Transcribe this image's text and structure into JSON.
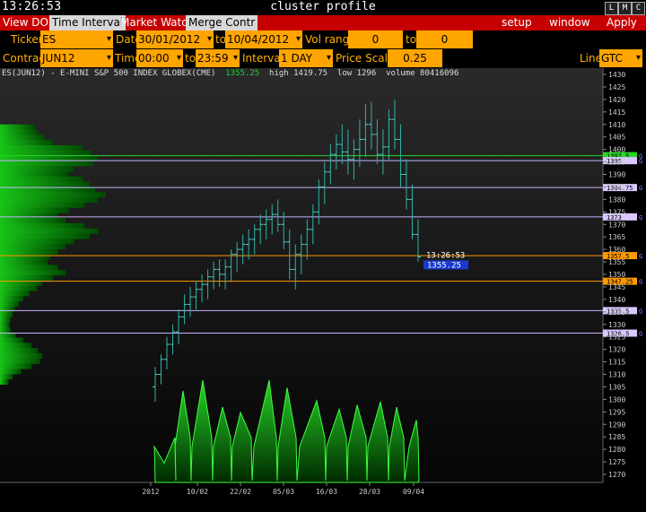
{
  "window": {
    "clock": "13:26:53",
    "title": "cluster profile",
    "buttons": [
      "L",
      "M",
      "C"
    ]
  },
  "menu": {
    "left": [
      "View DOM",
      "Time Interval",
      "Market Watch",
      "Merge Contr"
    ],
    "active": "Time Interval",
    "right": [
      "setup",
      "window",
      "Apply"
    ]
  },
  "controls": {
    "ticker_label": "Ticker",
    "ticker": "ES",
    "date_label": "Date",
    "date_from": "30/01/2012",
    "date_to_label": "to",
    "date_to": "10/04/2012",
    "vol_range_label": "Vol range",
    "vol_from": "0",
    "vol_to_label": "to",
    "vol_to": "0",
    "contract_label": "Contract",
    "contract": "JUN12",
    "time_label": "Time",
    "time_from": "00:00",
    "time_to_label": "to",
    "time_to": "23:59",
    "interval_label": "Interval",
    "interval": "1 DAY",
    "price_scale_label": "Price Scale",
    "price_scale": "0.25",
    "line_label": "Line",
    "line": "GTC"
  },
  "chart_data": {
    "type": "candlestick",
    "symbol": "ES(JUN12) - E-MINI S&P 500 INDEX GLOBEX(CME)",
    "last": "1355.25",
    "high_label": "high 1419.75",
    "low_label": "low 1296",
    "volume_label": "volume 80416096",
    "y_range": [
      1268,
      1432
    ],
    "y_ticks": [
      1430,
      1425,
      1420,
      1415,
      1410,
      1405,
      1400,
      1395,
      1390,
      1385,
      1380,
      1375,
      1370,
      1365,
      1360,
      1355,
      1350,
      1345,
      1340,
      1335,
      1330,
      1325,
      1320,
      1315,
      1310,
      1305,
      1300,
      1295,
      1290,
      1285,
      1280,
      1275,
      1270
    ],
    "x_labels": [
      "2012",
      "10/02",
      "22/02",
      "05/03",
      "16/03",
      "28/03",
      "09/04"
    ],
    "price_lines": [
      {
        "label": "1397.5",
        "value": 1397.5,
        "color": "#2ad52a",
        "tag_bg": "#2ad52a"
      },
      {
        "label": "1395",
        "value": 1395.5,
        "color": "#c9b4ff",
        "tag_bg": "#d9c8ff"
      },
      {
        "label": "1384.75",
        "value": 1384.75,
        "color": "#c9b4ff",
        "tag_bg": "#d9c8ff"
      },
      {
        "label": "1373",
        "value": 1373,
        "color": "#c9b4ff",
        "tag_bg": "#d9c8ff"
      },
      {
        "label": "1357.5",
        "value": 1357.5,
        "color": "#ff9900",
        "tag_bg": "#ff9900"
      },
      {
        "label": "1347.25",
        "value": 1347.25,
        "color": "#ff9900",
        "tag_bg": "#ff9900"
      },
      {
        "label": "1335.5",
        "value": 1335.5,
        "color": "#c9b4ff",
        "tag_bg": "#d9c8ff"
      },
      {
        "label": "1326.5",
        "value": 1326.5,
        "color": "#c9b4ff",
        "tag_bg": "#d9c8ff"
      }
    ],
    "line_flag": "G",
    "cursor_time": "13:26:53",
    "cursor_price": "1355.25",
    "candles": [
      [
        1305,
        1313,
        1299,
        1310
      ],
      [
        1310,
        1318,
        1306,
        1316
      ],
      [
        1316,
        1325,
        1312,
        1322
      ],
      [
        1322,
        1330,
        1318,
        1327
      ],
      [
        1327,
        1336,
        1322,
        1333
      ],
      [
        1333,
        1342,
        1330,
        1338
      ],
      [
        1338,
        1345,
        1333,
        1341
      ],
      [
        1341,
        1347,
        1336,
        1344
      ],
      [
        1344,
        1350,
        1339,
        1346
      ],
      [
        1346,
        1352,
        1340,
        1349
      ],
      [
        1349,
        1355,
        1344,
        1352
      ],
      [
        1352,
        1356,
        1345,
        1350
      ],
      [
        1350,
        1356,
        1344,
        1353
      ],
      [
        1353,
        1360,
        1347,
        1358
      ],
      [
        1358,
        1363,
        1351,
        1360
      ],
      [
        1360,
        1366,
        1354,
        1362
      ],
      [
        1362,
        1368,
        1356,
        1364
      ],
      [
        1364,
        1370,
        1358,
        1368
      ],
      [
        1368,
        1374,
        1362,
        1370
      ],
      [
        1370,
        1376,
        1364,
        1372
      ],
      [
        1372,
        1378,
        1366,
        1374
      ],
      [
        1374,
        1380,
        1367,
        1370
      ],
      [
        1370,
        1375,
        1360,
        1363
      ],
      [
        1363,
        1368,
        1348,
        1352
      ],
      [
        1352,
        1362,
        1344,
        1358
      ],
      [
        1358,
        1366,
        1350,
        1362
      ],
      [
        1362,
        1372,
        1356,
        1368
      ],
      [
        1368,
        1378,
        1362,
        1375
      ],
      [
        1375,
        1388,
        1370,
        1385
      ],
      [
        1385,
        1395,
        1378,
        1391
      ],
      [
        1391,
        1402,
        1386,
        1398
      ],
      [
        1398,
        1406,
        1392,
        1402
      ],
      [
        1402,
        1410,
        1394,
        1399
      ],
      [
        1399,
        1408,
        1390,
        1396
      ],
      [
        1396,
        1404,
        1388,
        1400
      ],
      [
        1400,
        1412,
        1393,
        1404
      ],
      [
        1404,
        1418,
        1397,
        1410
      ],
      [
        1410,
        1419,
        1400,
        1406
      ],
      [
        1406,
        1412,
        1394,
        1398
      ],
      [
        1398,
        1408,
        1390,
        1401
      ],
      [
        1401,
        1416,
        1396,
        1412
      ],
      [
        1412,
        1420,
        1400,
        1404
      ],
      [
        1404,
        1410,
        1385,
        1390
      ],
      [
        1390,
        1396,
        1376,
        1380
      ],
      [
        1380,
        1386,
        1364,
        1366
      ],
      [
        1366,
        1372,
        1355,
        1357
      ]
    ],
    "volume_profile": [
      0.33,
      0.36,
      0.42,
      0.5,
      0.78,
      0.86,
      0.92,
      0.88,
      0.7,
      0.65,
      0.78,
      0.85,
      0.9,
      1.0,
      0.92,
      0.8,
      0.65,
      0.55,
      0.62,
      0.8,
      0.93,
      0.85,
      0.7,
      0.62,
      0.55,
      0.47,
      0.45,
      0.55,
      0.62,
      0.5,
      0.4,
      0.35,
      0.28,
      0.22,
      0.18,
      0.14,
      0.12,
      0.1,
      0.09,
      0.1,
      0.15,
      0.22,
      0.3,
      0.36,
      0.4,
      0.38,
      0.3,
      0.2,
      0.12,
      0.08
    ]
  }
}
